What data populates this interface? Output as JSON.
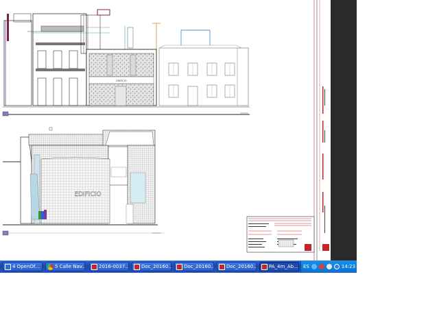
{
  "taskbar": {
    "tasks": [
      {
        "label": "4 OpenOf...",
        "icon": "openoffice-icon"
      },
      {
        "label": "5 Calle Nav...",
        "icon": "chrome-icon"
      },
      {
        "label": "2016-0037...",
        "icon": "pdf-icon"
      },
      {
        "label": "Doc_20160...",
        "icon": "pdf-icon"
      },
      {
        "label": "Doc_20160...",
        "icon": "pdf-icon"
      },
      {
        "label": "Doc_20160...",
        "icon": "pdf-icon"
      },
      {
        "label": "PA_4m_Ab...",
        "icon": "pdf-icon"
      }
    ],
    "tray": {
      "language": "ES",
      "time": "14:23"
    }
  },
  "drawing": {
    "sign_upper": "EDIFICIO",
    "sign_lower": "EDIFICIO"
  },
  "colors": {
    "taskbar": "#2356be",
    "tray": "#0c73d1",
    "scrollbar": "#2a2a2a",
    "title_block_red": "#c0262b"
  }
}
